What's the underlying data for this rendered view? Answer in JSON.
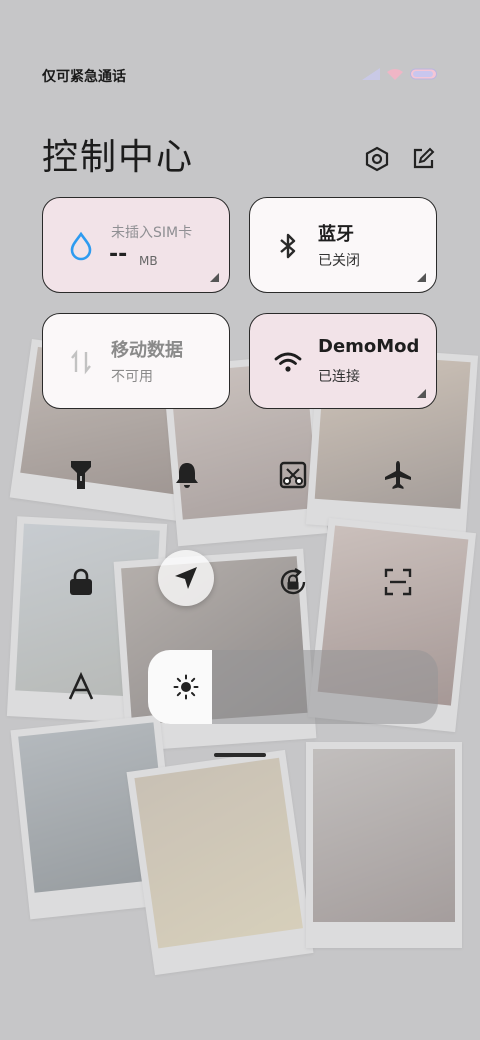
{
  "status_bar": {
    "carrier_text": "仅可紧急通话"
  },
  "header": {
    "title": "控制中心",
    "settings_icon": "settings-hexagon-icon",
    "edit_icon": "edit-icon"
  },
  "tiles": {
    "data_usage": {
      "title": "未插入SIM卡",
      "value": "--",
      "unit": "MB",
      "icon": "water-drop-icon",
      "accent": "#2e9bf0"
    },
    "bluetooth": {
      "title": "蓝牙",
      "status": "已关闭",
      "icon": "bluetooth-icon"
    },
    "mobile_data": {
      "title": "移动数据",
      "status": "不可用",
      "icon": "mobile-data-arrows-icon"
    },
    "wifi": {
      "title": "DemoMod",
      "status": "已连接",
      "icon": "wifi-icon"
    }
  },
  "toggles": [
    "flashlight-icon",
    "bell-icon",
    "screenshot-icon",
    "airplane-icon",
    "lock-icon",
    "location-icon",
    "rotation-lock-icon",
    "scan-icon",
    "font-icon",
    "brightness-icon"
  ],
  "brightness": {
    "level": 0.22
  },
  "colors": {
    "tile_pink": "#f2e3e8",
    "tile_white": "#fbf8f9",
    "accent_blue": "#2e9bf0"
  }
}
